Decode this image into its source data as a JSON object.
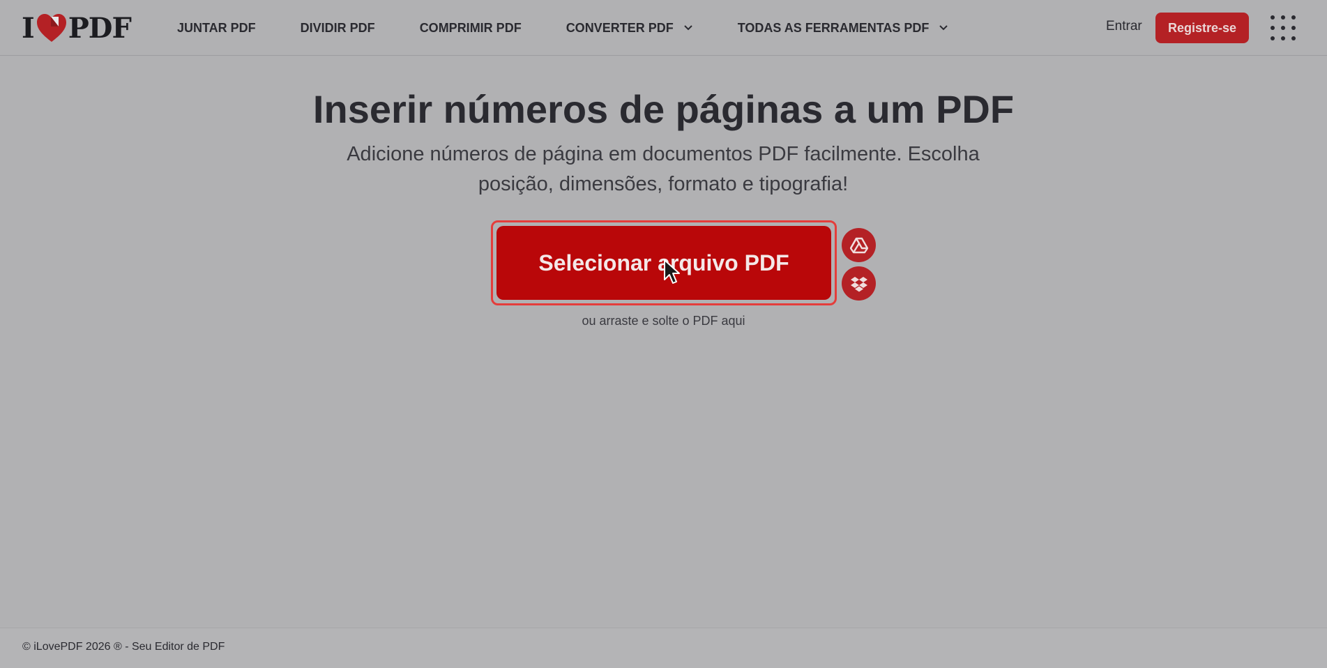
{
  "brand": {
    "letter_i": "I",
    "letters_pdf": "PDF"
  },
  "nav": {
    "items": [
      {
        "label": "JUNTAR PDF",
        "has_dropdown": false
      },
      {
        "label": "DIVIDIR PDF",
        "has_dropdown": false
      },
      {
        "label": "COMPRIMIR PDF",
        "has_dropdown": false
      },
      {
        "label": "CONVERTER PDF",
        "has_dropdown": true
      },
      {
        "label": "TODAS AS FERRAMENTAS PDF",
        "has_dropdown": true
      }
    ],
    "login_label": "Entrar",
    "register_label": "Registre-se",
    "apps_icon": "grid-9-dots-icon"
  },
  "main": {
    "title": "Inserir números de páginas a um PDF",
    "subtitle": "Adicione números de página em documentos PDF facilmente. Escolha posição, dimensões, formato e tipografia!",
    "select_button_label": "Selecionar arquivo PDF",
    "cloud_buttons": [
      "google-drive-icon",
      "dropbox-icon"
    ],
    "drop_hint": "ou arraste e solte o PDF aqui"
  },
  "footer": {
    "copyright": "© iLovePDF 2026 ® - Seu Editor de PDF"
  },
  "colors": {
    "brand_red": "#b90709",
    "accent_red": "#b42125",
    "background_overlay": "#b1b1b3",
    "text_dark": "#2a2a30"
  }
}
